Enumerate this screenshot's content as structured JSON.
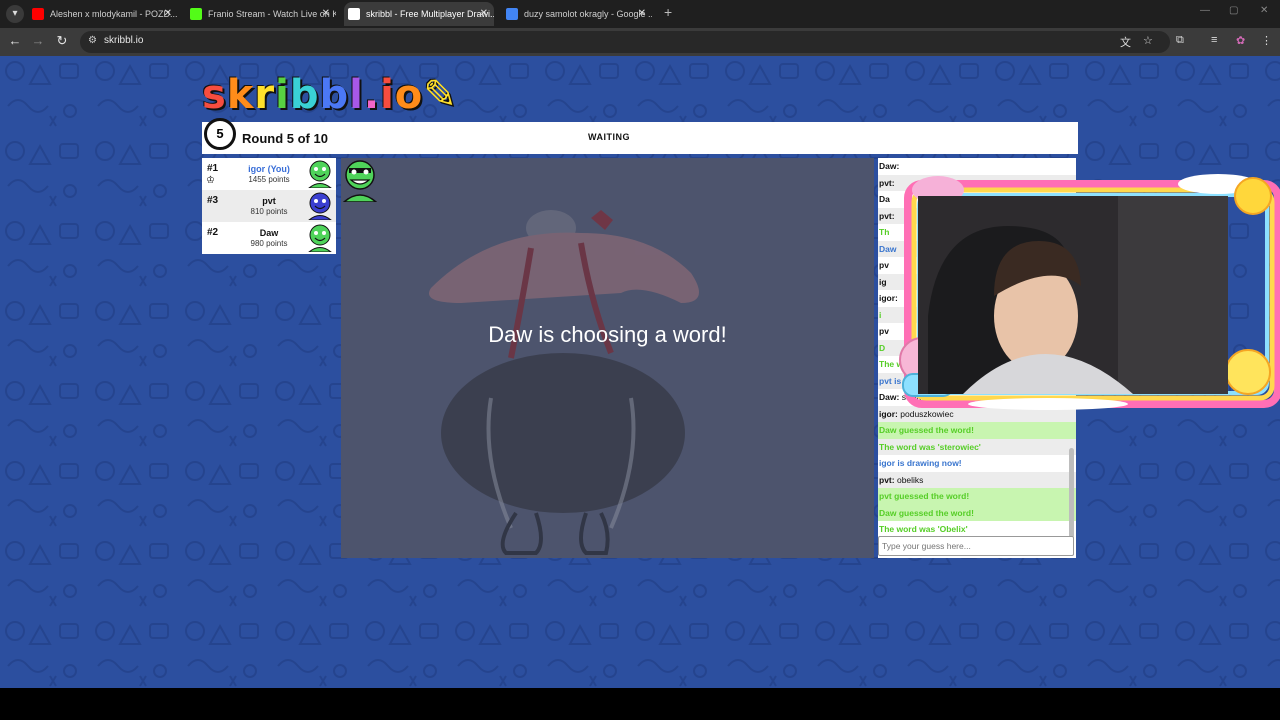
{
  "browser": {
    "tabs": [
      {
        "title": "Aleshen x mlodykamil - POZD...",
        "fav_color": "#ff0000",
        "active": false
      },
      {
        "title": "Franio Stream - Watch Live on K...",
        "fav_color": "#53fc18",
        "active": false
      },
      {
        "title": "skribbl - Free Multiplayer Drawi...",
        "fav_color": "#ffffff",
        "active": true
      },
      {
        "title": "duzy samolot okragly - Google ...",
        "fav_color": "#4285f4",
        "active": false
      }
    ],
    "url": "skribbl.io"
  },
  "game": {
    "logo": "skribbl.io",
    "round_number": "5",
    "round_text": "Round 5 of 10",
    "status": "WAITING",
    "players": [
      {
        "rank": "#1",
        "name": "igor (You)",
        "points": "1455 points",
        "you": true,
        "crown": true,
        "avatar_color": "#4fd35a"
      },
      {
        "rank": "#3",
        "name": "pvt",
        "points": "810 points",
        "you": false,
        "crown": false,
        "avatar_color": "#3b3fd0"
      },
      {
        "rank": "#2",
        "name": "Daw",
        "points": "980 points",
        "you": false,
        "crown": false,
        "avatar_color": "#4fd35a"
      }
    ],
    "overlay_text": "Daw is choosing a word!"
  },
  "chat": {
    "messages": [
      {
        "type": "chat",
        "author": "Daw:",
        "text": ""
      },
      {
        "type": "chat",
        "author": "pvt:",
        "text": ""
      },
      {
        "type": "chat",
        "author": "Da",
        "text": ""
      },
      {
        "type": "chat",
        "author": "pvt:",
        "text": ""
      },
      {
        "type": "green",
        "author": "",
        "text": "Th"
      },
      {
        "type": "blue",
        "author": "",
        "text": "Daw"
      },
      {
        "type": "chat",
        "author": "pv",
        "text": ""
      },
      {
        "type": "chat",
        "author": "ig",
        "text": ""
      },
      {
        "type": "chat",
        "author": "igor:",
        "text": ""
      },
      {
        "type": "green",
        "author": "",
        "text": "i"
      },
      {
        "type": "chat",
        "author": "pv",
        "text": ""
      },
      {
        "type": "green",
        "author": "",
        "text": "D"
      },
      {
        "type": "green",
        "author": "",
        "text": "The word was 'rakieta'"
      },
      {
        "type": "blue",
        "author": "",
        "text": "pvt is drawing now!"
      },
      {
        "type": "chat",
        "author": "Daw:",
        "text": "stolik"
      },
      {
        "type": "chat",
        "author": "igor:",
        "text": "poduszkowiec"
      },
      {
        "type": "guess",
        "author": "",
        "text": "Daw guessed the word!"
      },
      {
        "type": "green",
        "author": "",
        "text": "The word was 'sterowiec'"
      },
      {
        "type": "blue",
        "author": "",
        "text": "igor is drawing now!"
      },
      {
        "type": "chat",
        "author": "pvt:",
        "text": "obeliks"
      },
      {
        "type": "guess",
        "author": "",
        "text": "pvt guessed the word!"
      },
      {
        "type": "guess",
        "author": "",
        "text": "Daw guessed the word!"
      },
      {
        "type": "green",
        "author": "",
        "text": "The word was 'Obelix'"
      }
    ],
    "input_placeholder": "Type your guess here..."
  }
}
